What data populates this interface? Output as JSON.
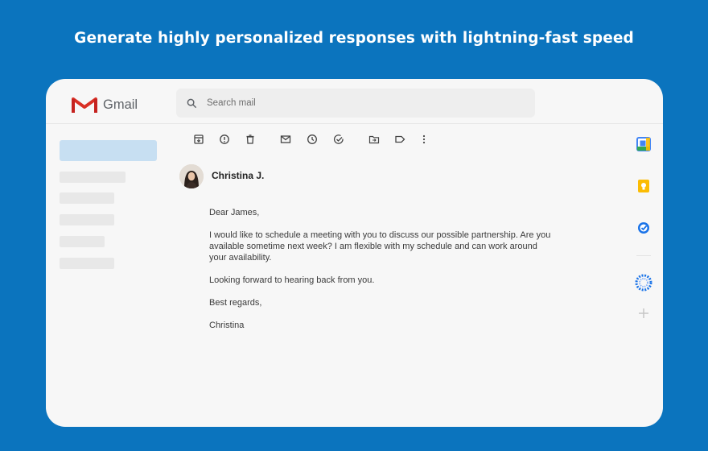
{
  "headline": "Generate highly personalized responses with lightning-fast speed",
  "gmail": {
    "logo_text": "Gmail",
    "search_placeholder": "Search mail"
  },
  "toolbar": {
    "icons": [
      "archive-icon",
      "report-spam-icon",
      "delete-icon",
      "mark-unread-icon",
      "snooze-icon",
      "add-task-icon",
      "move-to-icon",
      "label-icon",
      "more-icon"
    ]
  },
  "email": {
    "sender": "Christina J.",
    "greeting": "Dear James,",
    "paragraph1": "I would like to schedule a meeting with you to discuss our possible partnership. Are you available sometime next week? I am flexible with my schedule and can work around your availability.",
    "paragraph2": "Looking forward to hearing back from you.",
    "closing": "Best regards,",
    "signature": "Christina"
  },
  "side_apps": [
    "calendar-icon",
    "keep-icon",
    "tasks-icon",
    "extension-icon",
    "add-icon"
  ],
  "colors": {
    "background": "#0b74be",
    "card": "#f7f7f7",
    "nav_active": "#c7dff2"
  }
}
